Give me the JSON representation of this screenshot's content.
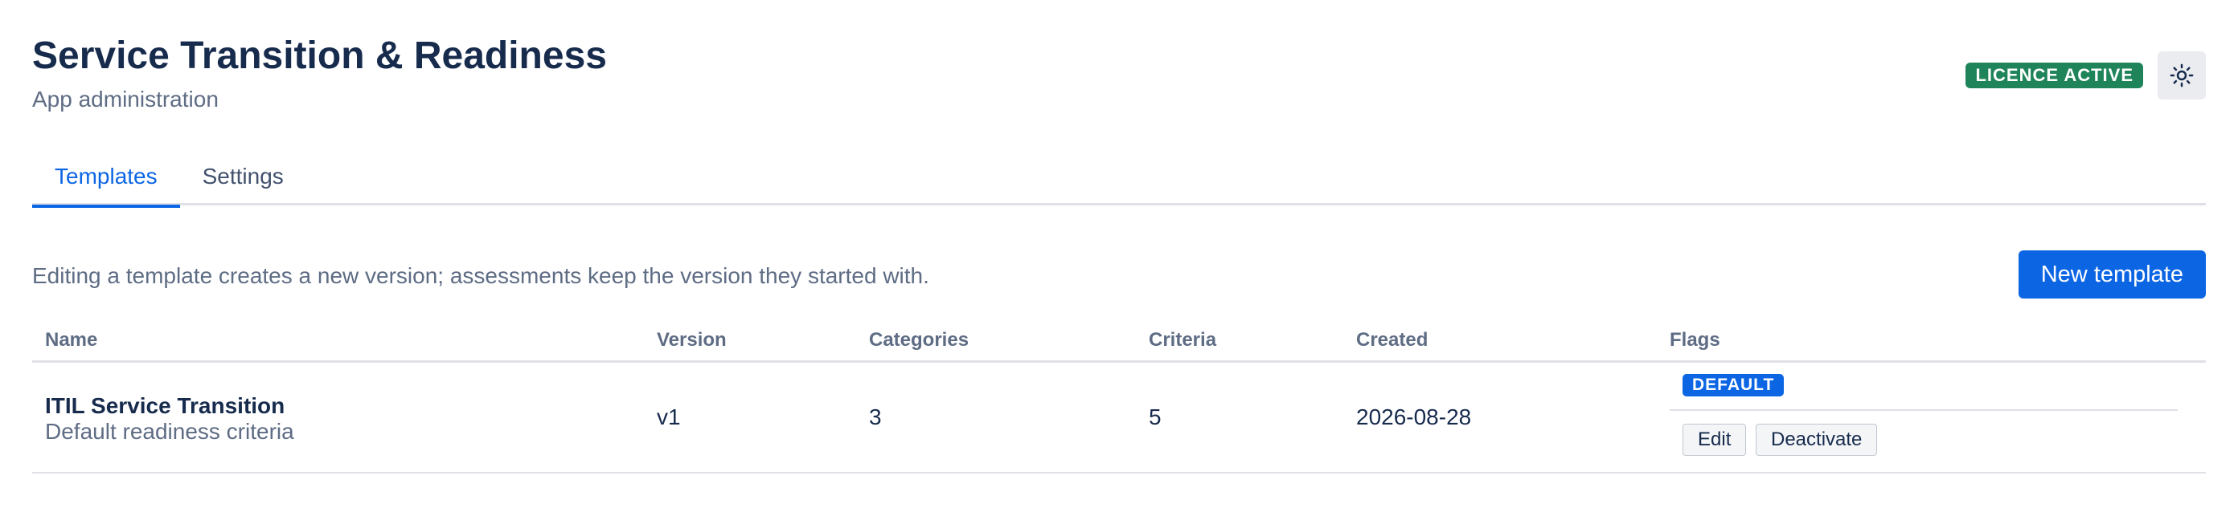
{
  "header": {
    "title": "Service Transition & Readiness",
    "subtitle": "App administration",
    "licence_badge": "LICENCE ACTIVE",
    "theme_icon": "sun-icon"
  },
  "tabs": [
    {
      "label": "Templates",
      "active": true
    },
    {
      "label": "Settings",
      "active": false
    }
  ],
  "info_text": "Editing a template creates a new version; assessments keep the version they started with.",
  "new_template_label": "New template",
  "table": {
    "columns": [
      "Name",
      "Version",
      "Categories",
      "Criteria",
      "Created",
      "Flags"
    ],
    "rows": [
      {
        "name": "ITIL Service Transition",
        "description": "Default readiness criteria",
        "version": "v1",
        "categories": "3",
        "criteria": "5",
        "created": "2026-08-28",
        "flag": "DEFAULT",
        "actions": [
          "Edit",
          "Deactivate"
        ]
      }
    ]
  },
  "colors": {
    "accent": "#0c66e4",
    "success": "#1f845a",
    "text": "#172b4d",
    "subtle_text": "#5e6c84"
  }
}
